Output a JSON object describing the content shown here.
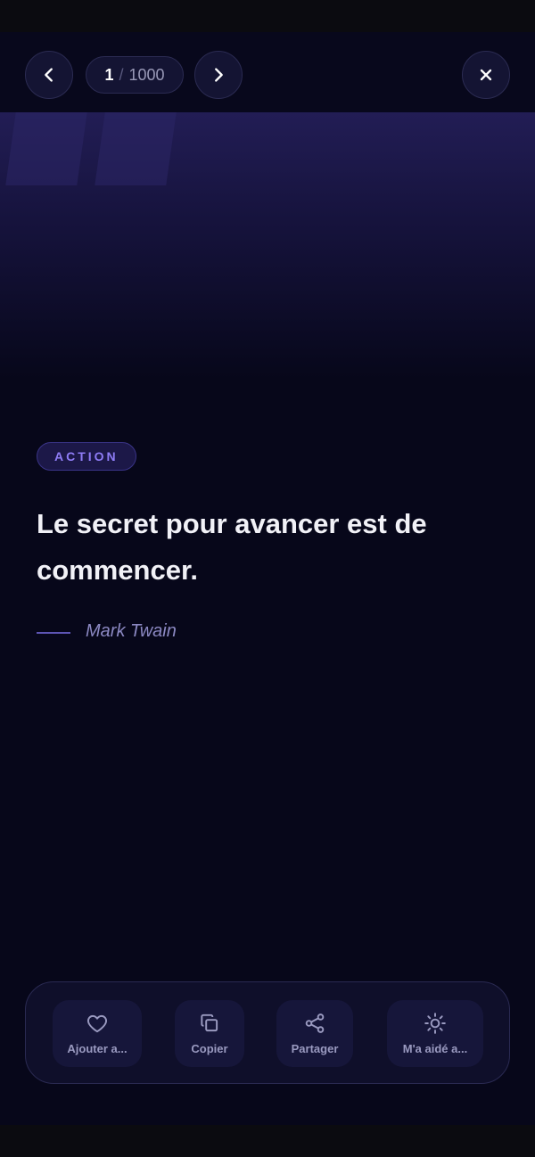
{
  "nav": {
    "counter_current": "1",
    "counter_separator": "/",
    "counter_total": "1000",
    "prev_icon": "chevron-left-icon",
    "next_icon": "chevron-right-icon",
    "close_icon": "close-icon"
  },
  "quote": {
    "category": "ACTION",
    "text": "Le secret pour avancer est de commencer.",
    "author": "Mark Twain"
  },
  "actions": [
    {
      "label": "Ajouter a...",
      "icon": "heart-icon"
    },
    {
      "label": "Copier",
      "icon": "copy-icon"
    },
    {
      "label": "Partager",
      "icon": "share-icon"
    },
    {
      "label": "M'a aidé a...",
      "icon": "sun-icon"
    }
  ],
  "colors": {
    "background": "#07071a",
    "accent": "#8e7cf5",
    "text": "#f1f1f7",
    "muted": "#9a9ac0"
  }
}
